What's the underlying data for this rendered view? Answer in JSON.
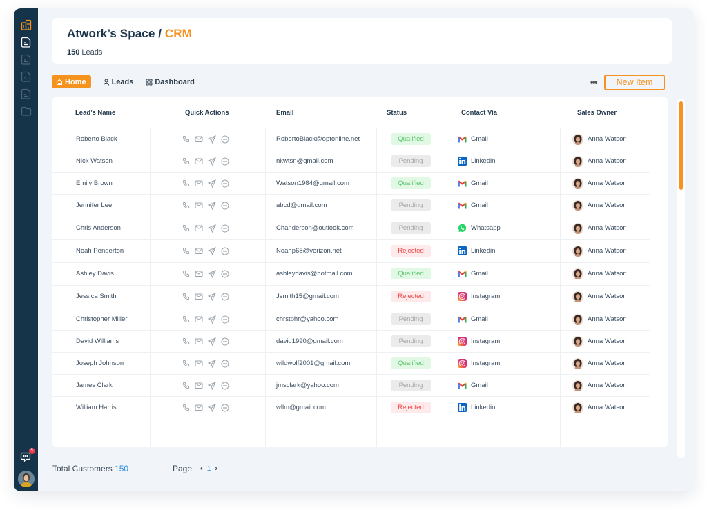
{
  "header": {
    "workspace": "Atwork’s Space /",
    "section": "CRM",
    "leads_count": "150",
    "leads_label": "Leads"
  },
  "tabs": [
    {
      "label": "Home",
      "icon": "home-icon",
      "active": true
    },
    {
      "label": "Leads",
      "icon": "user-icon",
      "active": false
    },
    {
      "label": "Dashboard",
      "icon": "grid-icon",
      "active": false
    }
  ],
  "toolbar": {
    "more_label": "•••",
    "new_item_label": "New Item"
  },
  "sidebar": {
    "items": [
      {
        "icon": "building-icon",
        "active": true
      },
      {
        "icon": "document-icon",
        "active": true
      },
      {
        "icon": "document-icon",
        "active": false
      },
      {
        "icon": "document-icon",
        "active": false
      },
      {
        "icon": "document-icon",
        "active": false
      },
      {
        "icon": "folder-icon",
        "active": false
      }
    ],
    "chat_badge": "5"
  },
  "table": {
    "columns": [
      "Lead’s Name",
      "Quick Actions",
      "Email",
      "Status",
      "Contact Via",
      "Sales Owner"
    ],
    "quick_actions": [
      "phone-icon",
      "mail-icon",
      "send-icon",
      "more-circle-icon"
    ],
    "rows": [
      {
        "name": "Roberto Black",
        "email": "RobertoBlack@optonline.net",
        "status": "Qualified",
        "contact": "Gmail",
        "owner": "Anna Watson"
      },
      {
        "name": "Nick Watson",
        "email": "nkwtsn@gmail.com",
        "status": "Pending",
        "contact": "Linkedin",
        "owner": "Anna Watson"
      },
      {
        "name": "Emily Brown",
        "email": "Watson1984@gmail.com",
        "status": "Qualified",
        "contact": "Gmail",
        "owner": "Anna Watson"
      },
      {
        "name": "Jennifer Lee",
        "email": "abcd@gmail.com",
        "status": "Pending",
        "contact": "Gmail",
        "owner": "Anna Watson"
      },
      {
        "name": "Chris Anderson",
        "email": "Chanderson@outlook.com",
        "status": "Pending",
        "contact": "Whatsapp",
        "owner": "Anna Watson"
      },
      {
        "name": "Noah Penderton",
        "email": "Noahp68@verizon.net",
        "status": "Rejected",
        "contact": "Linkedin",
        "owner": "Anna Watson"
      },
      {
        "name": "Ashley Davis",
        "email": "ashleydavis@hotmail.com",
        "status": "Qualified",
        "contact": "Gmail",
        "owner": "Anna Watson"
      },
      {
        "name": "Jessica Smith",
        "email": "Jsmith15@gmail.com",
        "status": "Rejected",
        "contact": "Instagram",
        "owner": "Anna Watson"
      },
      {
        "name": "Christopher Miller",
        "email": "chrstphr@yahoo.com",
        "status": "Pending",
        "contact": "Gmail",
        "owner": "Anna Watson"
      },
      {
        "name": "David Williams",
        "email": "david1990@gmail.com",
        "status": "Pending",
        "contact": "Instagram",
        "owner": "Anna Watson"
      },
      {
        "name": "Joseph Johnson",
        "email": "wildwolf2001@gmail.com",
        "status": "Qualified",
        "contact": "Instagram",
        "owner": "Anna Watson"
      },
      {
        "name": "James Clark",
        "email": "jmsclark@yahoo.com",
        "status": "Pending",
        "contact": "Gmail",
        "owner": "Anna Watson"
      },
      {
        "name": "William Harris",
        "email": "wllm@gmail.com",
        "status": "Rejected",
        "contact": "Linkedin",
        "owner": "Anna Watson"
      }
    ]
  },
  "footer": {
    "total_label": "Total Customers",
    "total_value": "150",
    "page_label": "Page",
    "prev": "‹",
    "current_page": "1",
    "next": "›"
  },
  "scrollbar": {
    "position_fraction": 0.0,
    "visible_fraction": 0.25
  },
  "colors": {
    "accent": "#f6921e",
    "sidebar": "#163449",
    "qualified": "#5fc46e",
    "pending": "#a5a5a5",
    "rejected": "#ee4a4a",
    "link_number": "#2e8ee0"
  }
}
